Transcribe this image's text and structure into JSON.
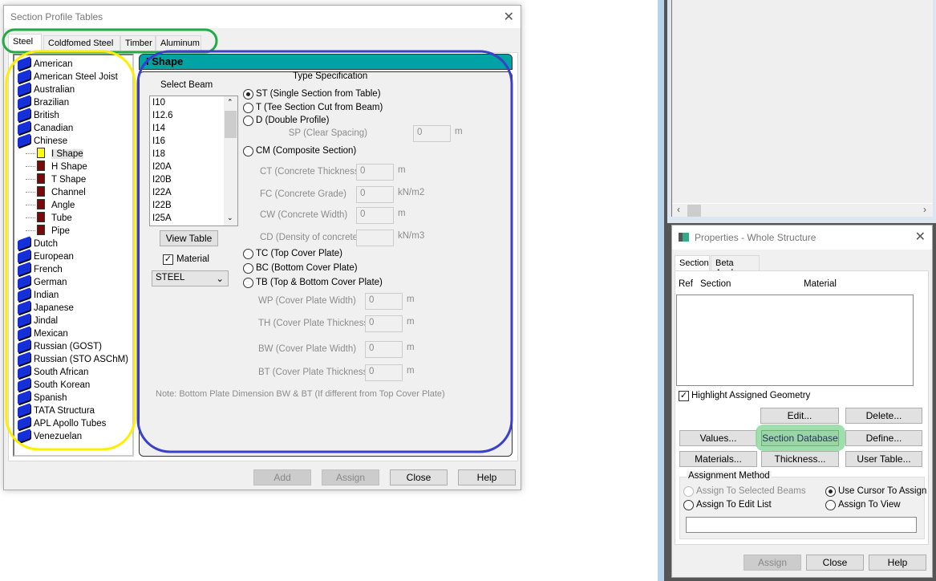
{
  "section_dialog": {
    "title": "Section Profile Tables",
    "tabs": [
      "Steel",
      "Coldfomed Steel",
      "Timber",
      "Aluminum"
    ],
    "tree": [
      {
        "label": "American",
        "type": "book"
      },
      {
        "label": "American Steel Joist",
        "type": "book"
      },
      {
        "label": "Australian",
        "type": "book"
      },
      {
        "label": "Brazilian",
        "type": "book"
      },
      {
        "label": "British",
        "type": "book"
      },
      {
        "label": "Canadian",
        "type": "book"
      },
      {
        "label": "Chinese",
        "type": "book"
      },
      {
        "label": "I Shape",
        "type": "child",
        "selected": true
      },
      {
        "label": "H Shape",
        "type": "child"
      },
      {
        "label": "T Shape",
        "type": "child"
      },
      {
        "label": "Channel",
        "type": "child"
      },
      {
        "label": "Angle",
        "type": "child"
      },
      {
        "label": "Tube",
        "type": "child"
      },
      {
        "label": "Pipe",
        "type": "child"
      },
      {
        "label": "Dutch",
        "type": "book"
      },
      {
        "label": "European",
        "type": "book"
      },
      {
        "label": "French",
        "type": "book"
      },
      {
        "label": "German",
        "type": "book"
      },
      {
        "label": "Indian",
        "type": "book"
      },
      {
        "label": "Japanese",
        "type": "book"
      },
      {
        "label": "Jindal",
        "type": "book"
      },
      {
        "label": "Mexican",
        "type": "book"
      },
      {
        "label": "Russian (GOST)",
        "type": "book"
      },
      {
        "label": "Russian (STO ASChM)",
        "type": "book"
      },
      {
        "label": "South African",
        "type": "book"
      },
      {
        "label": "South Korean",
        "type": "book"
      },
      {
        "label": "Spanish",
        "type": "book"
      },
      {
        "label": "TATA Structura",
        "type": "book"
      },
      {
        "label": "APL Apollo Tubes",
        "type": "book"
      },
      {
        "label": "Venezuelan",
        "type": "book"
      }
    ],
    "panel_header": "I Shape",
    "select_beam_label": "Select Beam",
    "beams": [
      "I10",
      "I12.6",
      "I14",
      "I16",
      "I18",
      "I20A",
      "I20B",
      "I22A",
      "I22B",
      "I25A"
    ],
    "view_table": "View Table",
    "material_label": "Material",
    "material_value": "STEEL",
    "type_spec_label": "Type Specification",
    "radios": {
      "st": "ST (Single Section from Table)",
      "t": "T (Tee Section Cut from Beam)",
      "d": "D (Double Profile)",
      "cm": "CM (Composite Section)",
      "tc": "TC (Top Cover Plate)",
      "bc": "BC (Bottom Cover Plate)",
      "tb": "TB (Top & Bottom Cover Plate)"
    },
    "fields": {
      "sp": {
        "label": "SP (Clear Spacing)",
        "value": "0",
        "unit": "m"
      },
      "ct": {
        "label": "CT (Concrete Thickness)",
        "value": "0",
        "unit": "m"
      },
      "fc": {
        "label": "FC (Concrete Grade)",
        "value": "0",
        "unit": "kN/m2"
      },
      "cw": {
        "label": "CW (Concrete Width)",
        "value": "0",
        "unit": "m"
      },
      "cd": {
        "label": "CD (Density of concrete)",
        "value": "",
        "unit": "kN/m3"
      },
      "wp": {
        "label": "WP (Cover Plate Width)",
        "value": "0",
        "unit": "m"
      },
      "th": {
        "label": "TH (Cover Plate Thickness)",
        "value": "0",
        "unit": "m"
      },
      "bw": {
        "label": "BW (Cover Plate Width)",
        "value": "0",
        "unit": "m"
      },
      "bt": {
        "label": "BT (Cover Plate Thickness)",
        "value": "0",
        "unit": "m"
      }
    },
    "note": "Note: Bottom Plate Dimension BW & BT (If different from Top Cover Plate)",
    "buttons": {
      "add": "Add",
      "assign": "Assign",
      "close": "Close",
      "help": "Help"
    }
  },
  "properties": {
    "title": "Properties - Whole Structure",
    "tabs": [
      "Section",
      "Beta Angle"
    ],
    "columns": {
      "ref": "Ref",
      "section": "Section",
      "material": "Material"
    },
    "highlight": "Highlight Assigned Geometry",
    "buttons": {
      "edit": "Edit...",
      "delete": "Delete...",
      "values": "Values...",
      "section_database": "Section Database",
      "define": "Define...",
      "materials": "Materials...",
      "thickness": "Thickness...",
      "user_table": "User Table...",
      "assign": "Assign",
      "close": "Close",
      "help": "Help"
    },
    "assignment_method": "Assignment Method",
    "methods": {
      "selected_beams": "Assign To Selected Beams",
      "cursor": "Use Cursor To Assign",
      "edit_list": "Assign To Edit List",
      "view": "Assign To View"
    },
    "edit_list_value": ""
  },
  "colors": {
    "teal": "#00a3a3",
    "annot_green": "#22aa44",
    "annot_yellow": "#ffee00",
    "annot_blue": "#3a3fcc",
    "highlight_green": "#8fd8a0"
  }
}
